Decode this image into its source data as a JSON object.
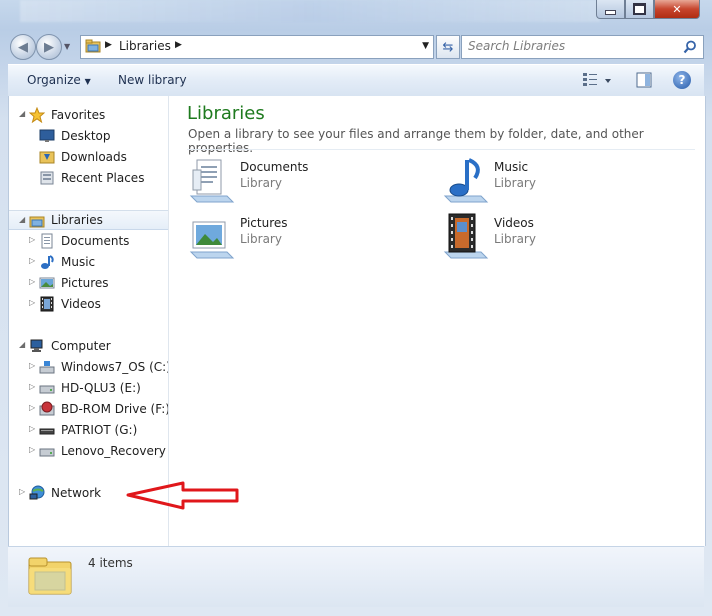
{
  "window": {
    "caption_buttons": {
      "minimize": "minimize-icon",
      "maximize": "maximize-icon",
      "close": "close-icon"
    }
  },
  "address": {
    "path": "Libraries",
    "search_placeholder": "Search Libraries"
  },
  "toolbar": {
    "organize_label": "Organize",
    "new_library_label": "New library"
  },
  "nav": {
    "favorites": {
      "label": "Favorites",
      "items": [
        {
          "label": "Desktop",
          "icon": "desktop-icon"
        },
        {
          "label": "Downloads",
          "icon": "downloads-folder-icon"
        },
        {
          "label": "Recent Places",
          "icon": "recent-places-icon"
        }
      ]
    },
    "libraries": {
      "label": "Libraries",
      "items": [
        {
          "label": "Documents",
          "icon": "documents-icon"
        },
        {
          "label": "Music",
          "icon": "music-icon"
        },
        {
          "label": "Pictures",
          "icon": "pictures-icon"
        },
        {
          "label": "Videos",
          "icon": "videos-icon"
        }
      ]
    },
    "computer": {
      "label": "Computer",
      "items": [
        {
          "label": "Windows7_OS (C:)",
          "icon": "os-drive-icon"
        },
        {
          "label": "HD-QLU3 (E:)",
          "icon": "hard-drive-icon"
        },
        {
          "label": "BD-ROM Drive (F:) V",
          "icon": "bd-rom-icon"
        },
        {
          "label": "PATRIOT (G:)",
          "icon": "usb-drive-icon"
        },
        {
          "label": "Lenovo_Recovery (Q",
          "icon": "hard-drive-icon"
        }
      ]
    },
    "network": {
      "label": "Network",
      "icon": "network-icon"
    }
  },
  "content": {
    "title": "Libraries",
    "subtitle": "Open a library to see your files and arrange them by folder, date, and other properties.",
    "libraries": [
      {
        "name": "Documents",
        "kind": "Library",
        "icon": "documents-library-icon"
      },
      {
        "name": "Music",
        "kind": "Library",
        "icon": "music-library-icon"
      },
      {
        "name": "Pictures",
        "kind": "Library",
        "icon": "pictures-library-icon"
      },
      {
        "name": "Videos",
        "kind": "Library",
        "icon": "videos-library-icon"
      }
    ]
  },
  "details": {
    "count_text": "4 items"
  },
  "annotation": {
    "color": "#e0171b",
    "points_to": "Network"
  }
}
